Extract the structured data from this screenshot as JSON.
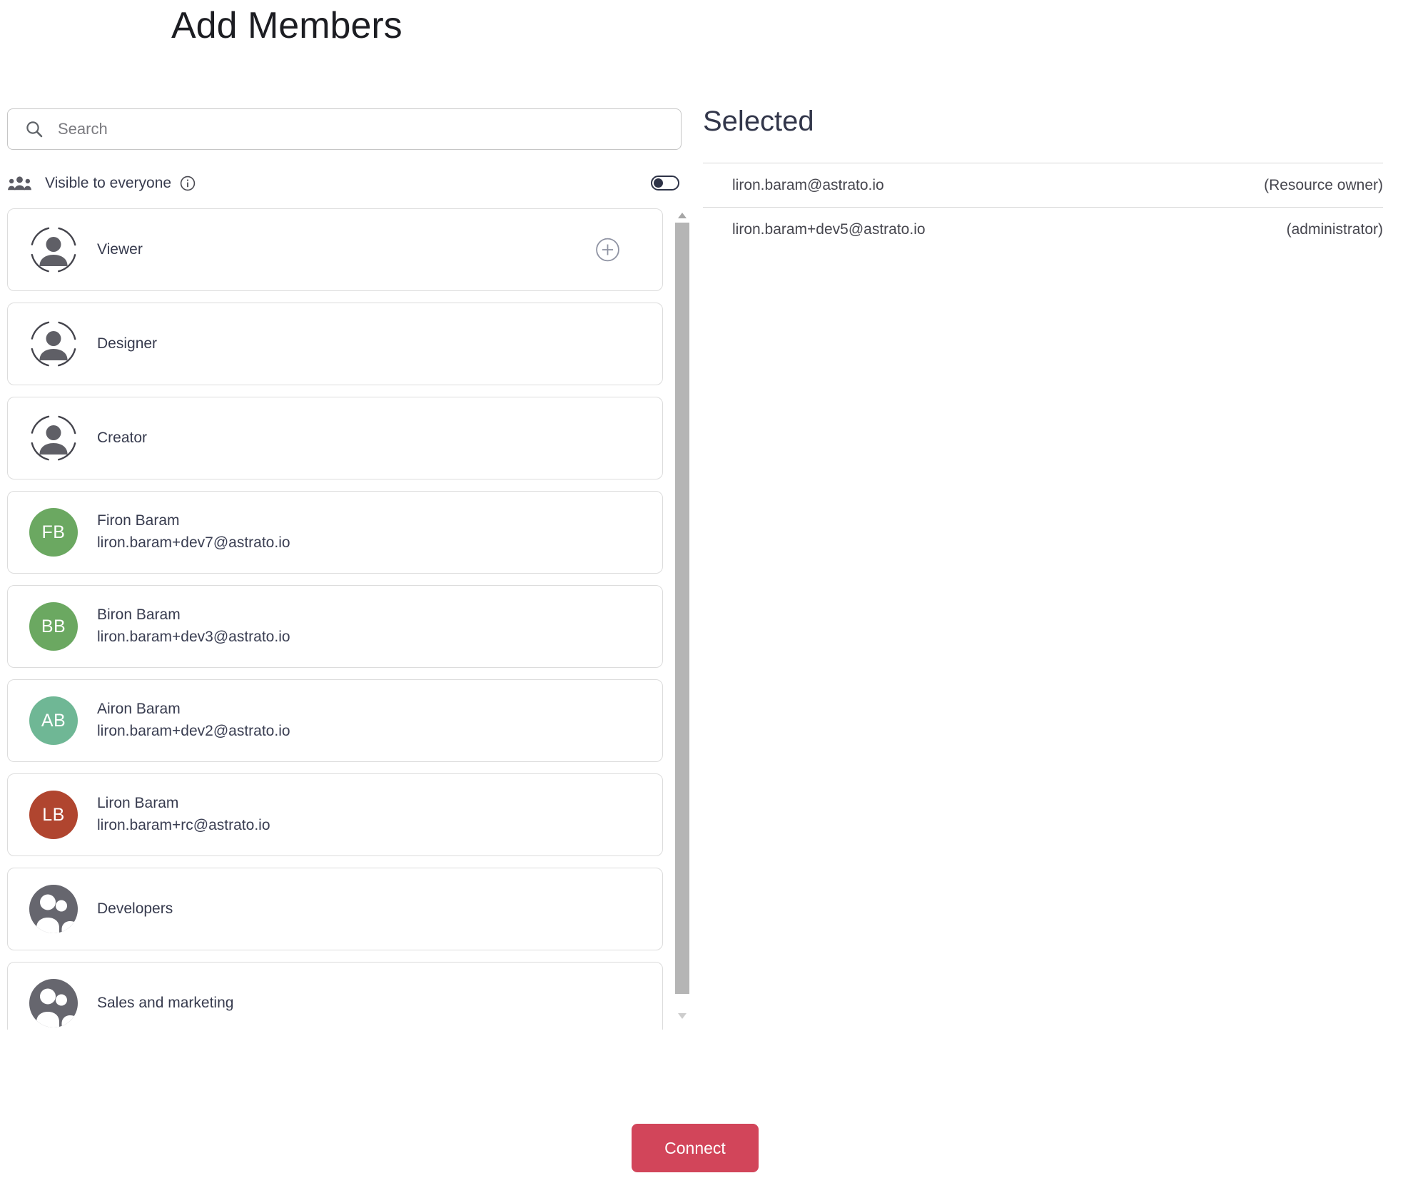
{
  "page": {
    "title": "Add Members"
  },
  "search": {
    "placeholder": "Search",
    "value": ""
  },
  "visibility": {
    "label": "Visible to everyone",
    "toggle_state": "off"
  },
  "members_list": {
    "items": [
      {
        "kind": "role",
        "name": "Viewer",
        "has_add_button": true
      },
      {
        "kind": "role",
        "name": "Designer"
      },
      {
        "kind": "role",
        "name": "Creator"
      },
      {
        "kind": "user",
        "name": "Firon Baram",
        "email": "liron.baram+dev7@astrato.io",
        "initials": "FB",
        "color": "#6BA861"
      },
      {
        "kind": "user",
        "name": "Biron Baram",
        "email": "liron.baram+dev3@astrato.io",
        "initials": "BB",
        "color": "#6BA861"
      },
      {
        "kind": "user",
        "name": "Airon Baram",
        "email": "liron.baram+dev2@astrato.io",
        "initials": "AB",
        "color": "#6FB795"
      },
      {
        "kind": "user",
        "name": "Liron Baram",
        "email": "liron.baram+rc@astrato.io",
        "initials": "LB",
        "color": "#B0452F"
      },
      {
        "kind": "group",
        "name": "Developers"
      },
      {
        "kind": "group",
        "name": "Sales and marketing"
      }
    ]
  },
  "selected": {
    "heading": "Selected",
    "rows": [
      {
        "email": "liron.baram@astrato.io",
        "role": "(Resource owner)"
      },
      {
        "email": "liron.baram+dev5@astrato.io",
        "role": "(administrator)"
      }
    ]
  },
  "actions": {
    "connect_label": "Connect"
  },
  "colors": {
    "accent": "#D2455A",
    "role_icon_person": "#5F5F66",
    "role_icon_arcs": "#44444C",
    "group_icon_circle": "#66666E",
    "scrollbar_thumb": "#B5B5B5"
  }
}
